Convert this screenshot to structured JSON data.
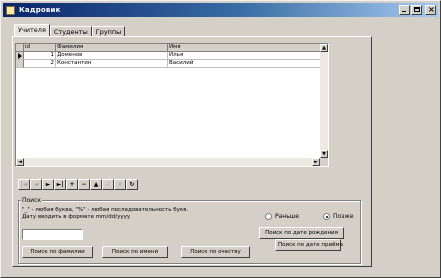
{
  "window": {
    "title": "Кадровик"
  },
  "tabs": [
    "Учителя",
    "Студенты",
    "Группы"
  ],
  "grid": {
    "columns": [
      "id",
      "Фамилия",
      "Имя"
    ],
    "rows": [
      {
        "id": "1",
        "last": "Доменов",
        "first": "Илья"
      },
      {
        "id": "2",
        "last": "Константин",
        "first": "Василий"
      }
    ]
  },
  "navigator": {
    "buttons": [
      {
        "name": "nav-first-button",
        "glyph": "|◄",
        "enabled": false
      },
      {
        "name": "nav-prior-button",
        "glyph": "◄",
        "enabled": false
      },
      {
        "name": "nav-next-button",
        "glyph": "►",
        "enabled": true
      },
      {
        "name": "nav-last-button",
        "glyph": "►|",
        "enabled": true
      },
      {
        "name": "nav-insert-button",
        "glyph": "+",
        "enabled": true
      },
      {
        "name": "nav-delete-button",
        "glyph": "−",
        "enabled": true
      },
      {
        "name": "nav-edit-button",
        "glyph": "▲",
        "enabled": true
      },
      {
        "name": "nav-post-button",
        "glyph": "✓",
        "enabled": false
      },
      {
        "name": "nav-cancel-button",
        "glyph": "✕",
        "enabled": false
      },
      {
        "name": "nav-refresh-button",
        "glyph": "↻",
        "enabled": true
      }
    ]
  },
  "search": {
    "group_title": "Поиск",
    "hint_line1": "\"_\" - любая буква, \"%\" - любая последовательность букв.",
    "hint_line2": "Дату вводить в формате mm/dd/yyyy",
    "input_value": "",
    "btn_surname": "Поиск по фамилии",
    "btn_name": "Поиск по имени",
    "btn_patronymic": "Поиск по очеству",
    "radio_earlier": "Раньше",
    "radio_later": "Позже",
    "btn_birth_date": "Поиск по дате рождения",
    "btn_hire_date": "Поиск по дате приёма"
  }
}
